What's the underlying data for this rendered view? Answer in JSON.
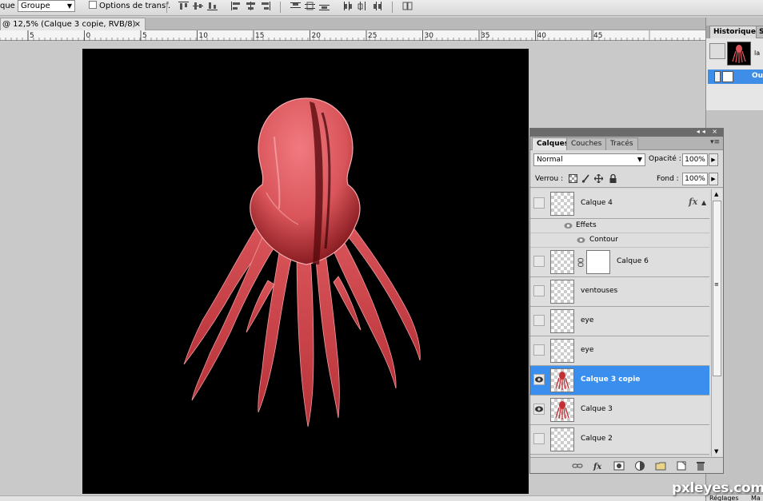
{
  "options_bar": {
    "group_label": "que :",
    "group_value": "Groupe",
    "transform_label": "Options de transf."
  },
  "document": {
    "tab_title": "@ 12,5% (Calque 3 copie, RVB/8)",
    "close_glyph": "×"
  },
  "ruler": {
    "labels": [
      "5",
      "0",
      "5",
      "10",
      "15",
      "20",
      "25",
      "30",
      "35",
      "40",
      "45"
    ]
  },
  "history_panel": {
    "tab_label": "Historique",
    "tab2_label": "S",
    "snapshot_label": "la",
    "state_label": "Ouv"
  },
  "layers_panel": {
    "tabs": [
      {
        "label": "Calques",
        "active": true
      },
      {
        "label": "Couches",
        "active": false
      },
      {
        "label": "Tracés",
        "active": false
      }
    ],
    "menu_glyph": "▾≡",
    "blend_mode": "Normal",
    "opacity_label": "Opacité :",
    "opacity_value": "100%",
    "lock_label": "Verrou :",
    "fill_label": "Fond :",
    "fill_value": "100%",
    "layers": [
      {
        "name": "Calque 4",
        "visible": false,
        "selected": false,
        "has_fx": true,
        "fx_label": "fx"
      },
      {
        "name": "Calque 6",
        "visible": false,
        "selected": false,
        "has_mask": true
      },
      {
        "name": "ventouses",
        "visible": false,
        "selected": false
      },
      {
        "name": "eye",
        "visible": false,
        "selected": false
      },
      {
        "name": "eye",
        "visible": false,
        "selected": false
      },
      {
        "name": "Calque 3 copie",
        "visible": true,
        "selected": true,
        "thumb": "octopus"
      },
      {
        "name": "Calque 3",
        "visible": true,
        "selected": false,
        "thumb": "octopus"
      },
      {
        "name": "Calque 2",
        "visible": false,
        "selected": false
      }
    ],
    "effects": {
      "label": "Effets",
      "item": "Contour"
    }
  },
  "dock": {
    "bottom_tab": "Réglages",
    "bottom_tab2": "Ma"
  },
  "watermark": "pxleyes.com",
  "colors": {
    "selection": "#3a8fee",
    "octopus": "#d9555a",
    "canvas": "#000000"
  }
}
